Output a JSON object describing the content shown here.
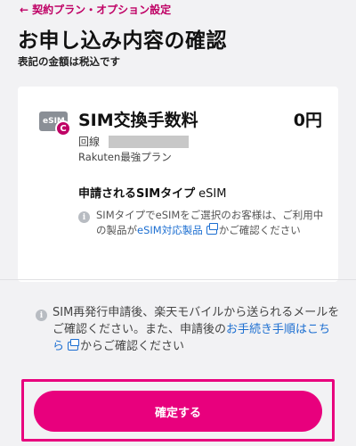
{
  "header": {
    "back_arrow": "←",
    "back_label": "契約プラン・オプション設定",
    "title": "お申し込み内容の確認",
    "subtitle": "表記の金額は税込です"
  },
  "fee_card": {
    "icon": "sim-card-icon",
    "icon_text": "eSIM",
    "badge_text": "C",
    "name": "SIM交換手数料",
    "price": "0円",
    "line_label": "回線",
    "plan_name": "Rakuten最強プラン",
    "sim_type_label": "申請されるSIMタイプ",
    "sim_type_value": "eSIM",
    "note_before": "SIMタイプでeSIMをご選択のお客様は、ご利用中の製品が",
    "note_link": "eSIM対応製品",
    "note_after": "かご確認ください"
  },
  "bottom_note": {
    "text_before": "SIM再発行申請後、楽天モバイルから送られるメールをご確認ください。また、申請後の",
    "link": "お手続き手順はこちら",
    "text_after": "からご確認ください"
  },
  "confirm_button": {
    "label": "確定する"
  },
  "colors": {
    "brand": "#bf0065",
    "button": "#e8007d",
    "link": "#1d6fd1",
    "background": "#f2f2f4"
  }
}
